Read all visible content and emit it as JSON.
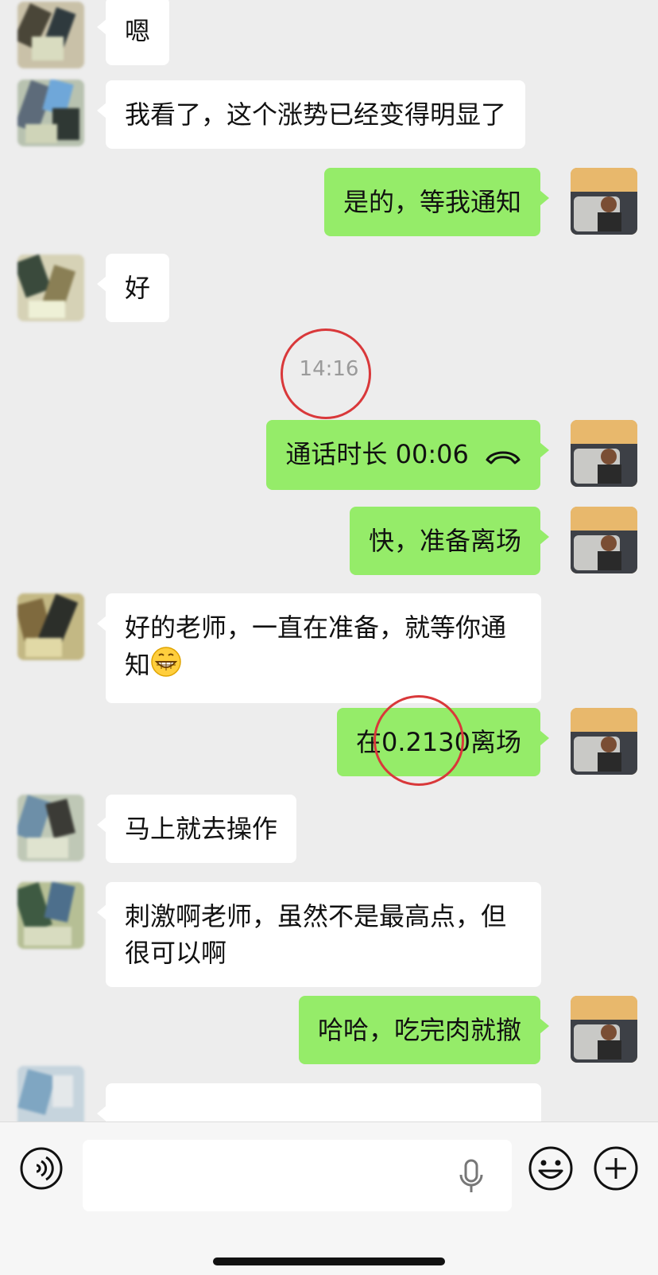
{
  "messages": [
    {
      "side": "left",
      "text": "嗯"
    },
    {
      "side": "left",
      "text": "我看了，这个涨势已经变得明显了"
    },
    {
      "side": "right",
      "text": "是的，等我通知"
    },
    {
      "side": "left",
      "text": "好"
    },
    {
      "time": "14:16"
    },
    {
      "side": "right",
      "text": "通话时长 00:06",
      "icon": "phone-hangup-icon"
    },
    {
      "side": "right",
      "text": "快，准备离场"
    },
    {
      "side": "left",
      "text": "好的老师，一直在准备，就等你通知",
      "emoji": "grinning-face-icon"
    },
    {
      "side": "right",
      "text": "在0.2130离场"
    },
    {
      "side": "left",
      "text": "马上就去操作"
    },
    {
      "side": "left",
      "text": "刺激啊老师，虽然不是最高点，但很可以啊"
    },
    {
      "side": "right",
      "text": "哈哈，吃完肉就撤"
    }
  ],
  "input_bar": {
    "voice_icon": "voice-icon",
    "mic_icon": "microphone-icon",
    "emoji_icon": "emoji-icon",
    "plus_icon": "plus-icon"
  },
  "colors": {
    "background": "#ededed",
    "my_bubble": "#95ec69",
    "their_bubble": "#ffffff",
    "highlight_circle": "#d9383a"
  }
}
